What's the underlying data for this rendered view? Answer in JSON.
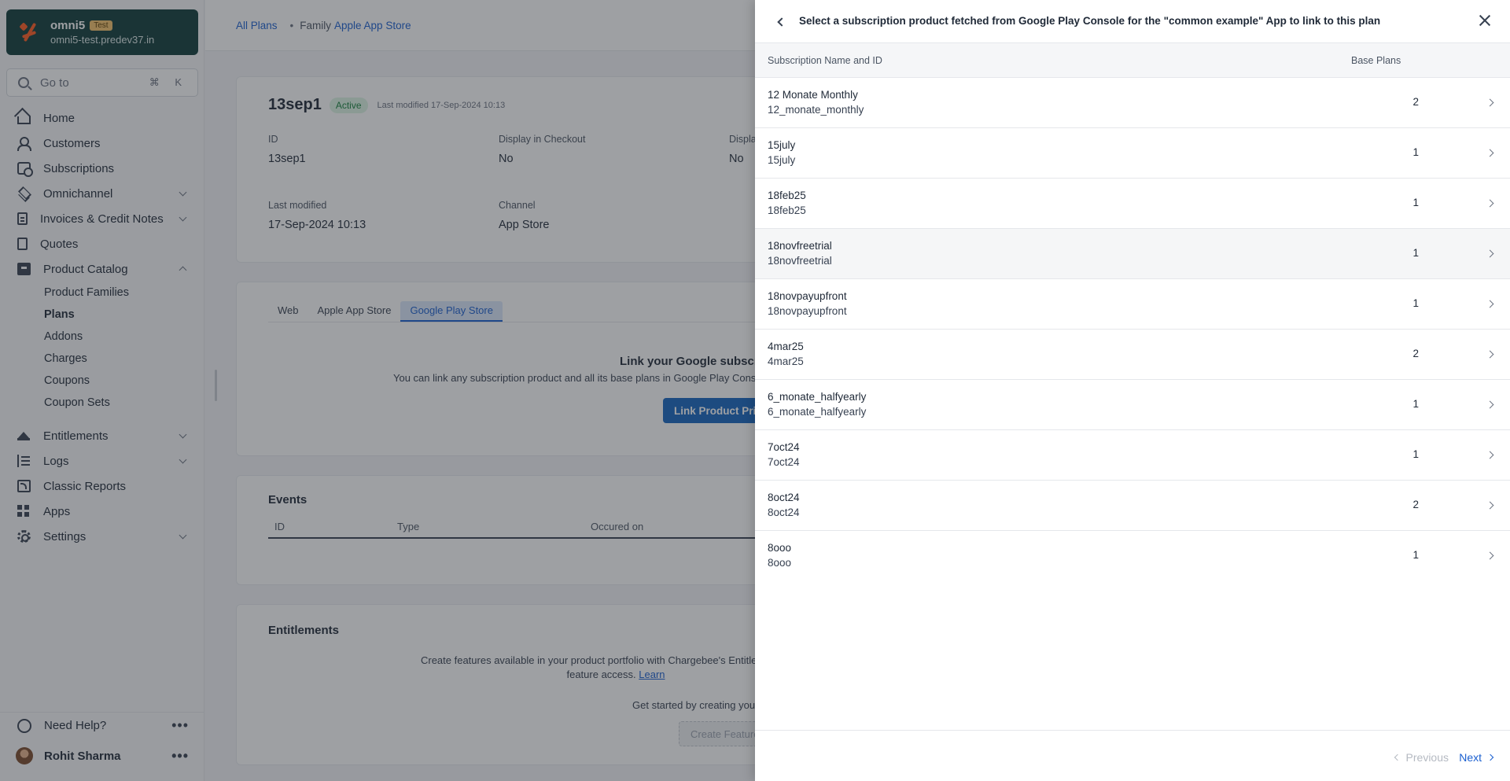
{
  "brand": {
    "name": "omni5",
    "badge": "Test",
    "domain": "omni5-test.predev37.in"
  },
  "search": {
    "placeholder": "Go to",
    "shortcut": "⌘ K"
  },
  "sidebar": {
    "items": [
      {
        "label": "Home"
      },
      {
        "label": "Customers"
      },
      {
        "label": "Subscriptions"
      },
      {
        "label": "Omnichannel"
      },
      {
        "label": "Invoices & Credit Notes"
      },
      {
        "label": "Quotes"
      },
      {
        "label": "Product Catalog"
      }
    ],
    "product_catalog_sub": [
      "Product Families",
      "Plans",
      "Addons",
      "Charges",
      "Coupons",
      "Coupon Sets"
    ],
    "items2": [
      {
        "label": "Entitlements"
      },
      {
        "label": "Logs"
      },
      {
        "label": "Classic Reports"
      },
      {
        "label": "Apps"
      },
      {
        "label": "Settings"
      }
    ],
    "help": "Need Help?",
    "user": "Rohit Sharma"
  },
  "breadcrumb": {
    "all_plans": "All Plans",
    "family_label": "Family",
    "family_value": "Apple App Store"
  },
  "plan": {
    "title": "13sep1",
    "status": "Active",
    "last_modified_small": "Last modified 17-Sep-2024 10:13",
    "id_label": "ID",
    "id_value": "13sep1",
    "display_label": "Display in Checkout",
    "display_value": "No",
    "display2_label": "Displa",
    "display2_value": "No",
    "lastmod_label": "Last modified",
    "lastmod_value": "17-Sep-2024 10:13",
    "channel_label": "Channel",
    "channel_value": "App Store"
  },
  "channel_tabs": [
    "Web",
    "Apple App Store",
    "Google Play Store"
  ],
  "google_link": {
    "title": "Link your Google subscrip",
    "desc": "You can link any subscription product and all its base plans in Google Play Consol",
    "button": "Link Product Pric"
  },
  "events": {
    "title": "Events",
    "columns": [
      "ID",
      "Type",
      "Occured on"
    ]
  },
  "entitlements": {
    "title": "Entitlements",
    "desc_line1": "Create features available in your product portfolio with Chargebee's Entitlements. Enjo",
    "desc_line2": "feature access. ",
    "desc_link": "Learn",
    "start": "Get started by creating you",
    "button": "Create Feature"
  },
  "drawer": {
    "title": "Select a subscription product fetched from Google Play Console for the \"common example\" App to link to this plan",
    "col_name": "Subscription Name and ID",
    "col_plans": "Base Plans",
    "rows": [
      {
        "name": "12 Monate Monthly",
        "id": "12_monate_monthly",
        "plans": "2"
      },
      {
        "name": "15july",
        "id": "15july",
        "plans": "1"
      },
      {
        "name": "18feb25",
        "id": "18feb25",
        "plans": "1"
      },
      {
        "name": "18novfreetrial",
        "id": "18novfreetrial",
        "plans": "1"
      },
      {
        "name": "18novpayupfront",
        "id": "18novpayupfront",
        "plans": "1"
      },
      {
        "name": "4mar25",
        "id": "4mar25",
        "plans": "2"
      },
      {
        "name": "6_monate_halfyearly",
        "id": "6_monate_halfyearly",
        "plans": "1"
      },
      {
        "name": "7oct24",
        "id": "7oct24",
        "plans": "1"
      },
      {
        "name": "8oct24",
        "id": "8oct24",
        "plans": "2"
      },
      {
        "name": "8ooo",
        "id": "8ooo",
        "plans": "1"
      }
    ],
    "prev": "Previous",
    "next": "Next"
  },
  "icons": [
    "search-icon",
    "home-icon",
    "user-icon",
    "subscription-icon",
    "layers-icon",
    "invoice-icon",
    "quote-icon",
    "box-icon",
    "crown-icon",
    "log-icon",
    "report-icon",
    "apps-icon",
    "gear-icon",
    "help-icon",
    "back-icon",
    "close-icon",
    "chevron-right-icon"
  ]
}
